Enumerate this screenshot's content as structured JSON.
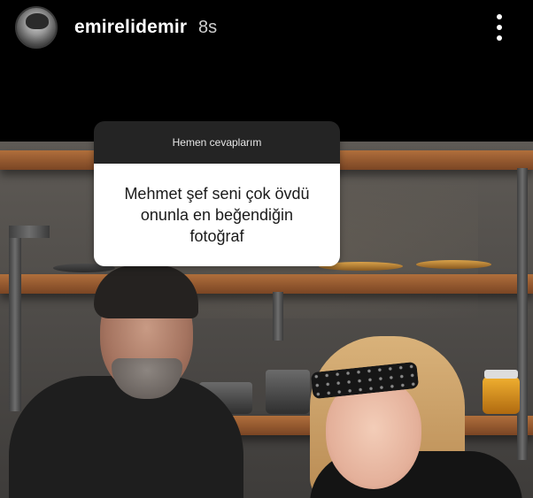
{
  "story": {
    "username": "emirelidemir",
    "time": "8s",
    "avatar_icon": "avatar",
    "more_icon": "more-vertical-icon"
  },
  "question_sticker": {
    "header": "Hemen cevaplarım",
    "question": "Mehmet şef seni çok övdü\nonunla en beğendiğin\nfotoğraf"
  },
  "colors": {
    "sticker_header_bg": "#242424",
    "sticker_body_bg": "#ffffff",
    "shelf_wood": "#b06f3c"
  }
}
